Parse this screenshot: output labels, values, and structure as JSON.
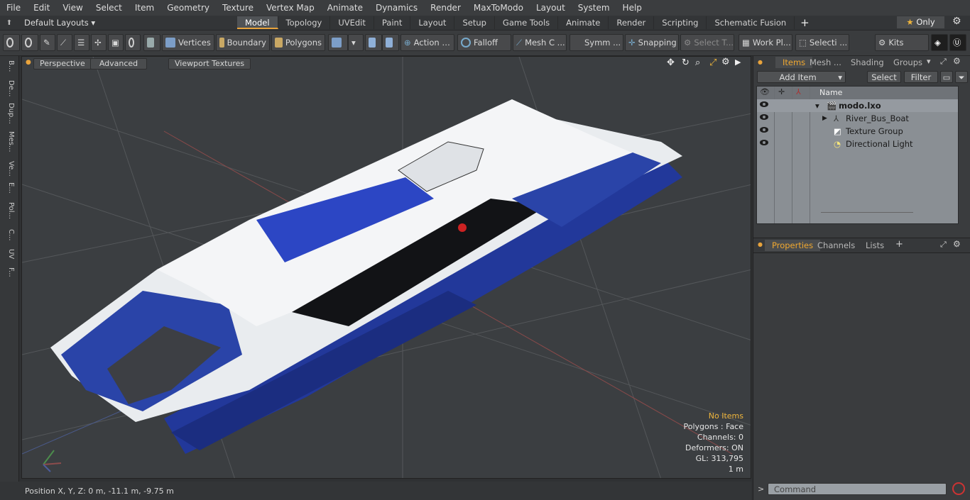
{
  "menu": [
    "File",
    "Edit",
    "View",
    "Select",
    "Item",
    "Geometry",
    "Texture",
    "Vertex Map",
    "Animate",
    "Dynamics",
    "Render",
    "MaxToModo",
    "Layout",
    "System",
    "Help"
  ],
  "layout": {
    "dropdown": "Default Layouts",
    "tabs": [
      "Model",
      "Topology",
      "UVEdit",
      "Paint",
      "Layout",
      "Setup",
      "Game Tools",
      "Animate",
      "Render",
      "Scripting",
      "Schematic Fusion"
    ],
    "active_tab": "Model",
    "add_tab": "+",
    "only_label": "Only"
  },
  "toolbar": {
    "vertices": "Vertices",
    "boundary": "Boundary",
    "polygons": "Polygons",
    "action": "Action",
    "falloff": "Falloff",
    "mesh": "Mesh C ...",
    "symm": "Symm ...",
    "snapping": "Snapping",
    "select_t": "Select T...",
    "work_pl": "Work Pl...",
    "selecti": "Selecti ...",
    "kits": "Kits"
  },
  "left_tabs": [
    "B...",
    "De...",
    "Dup...",
    "Mes...",
    "Ve...",
    "E...",
    "Pol...",
    "C...",
    "UV",
    "F..."
  ],
  "viewport": {
    "perspective": "Perspective",
    "advanced": "Advanced",
    "viewport_textures": "Viewport Textures",
    "hud": {
      "no_items": "No Items",
      "polygons": "Polygons : Face",
      "channels": "Channels: 0",
      "deformers": "Deformers: ON",
      "gl": "GL: 313,795",
      "scale": "1 m"
    }
  },
  "status": {
    "position": "Position X, Y, Z:   0 m, -11.1 m, -9.75 m"
  },
  "items_panel": {
    "tabs": [
      "Items",
      "Mesh ...",
      "Shading",
      "Groups"
    ],
    "active": "Items",
    "add_item": "Add Item",
    "select": "Select",
    "filter": "Filter",
    "name_header": "Name",
    "rows": [
      {
        "label": "modo.lxo"
      },
      {
        "label": "River_Bus_Boat"
      },
      {
        "label": "Texture Group"
      },
      {
        "label": "Directional Light"
      }
    ]
  },
  "properties_panel": {
    "tabs": [
      "Properties",
      "Channels",
      "Lists"
    ],
    "active": "Properties",
    "add": "+"
  },
  "command": {
    "placeholder": "Command",
    "prompt": ">"
  },
  "colors": {
    "accent": "#e8a33c",
    "hull_blue": "#2a44a8",
    "hud_yellow": "#f0b63c"
  }
}
